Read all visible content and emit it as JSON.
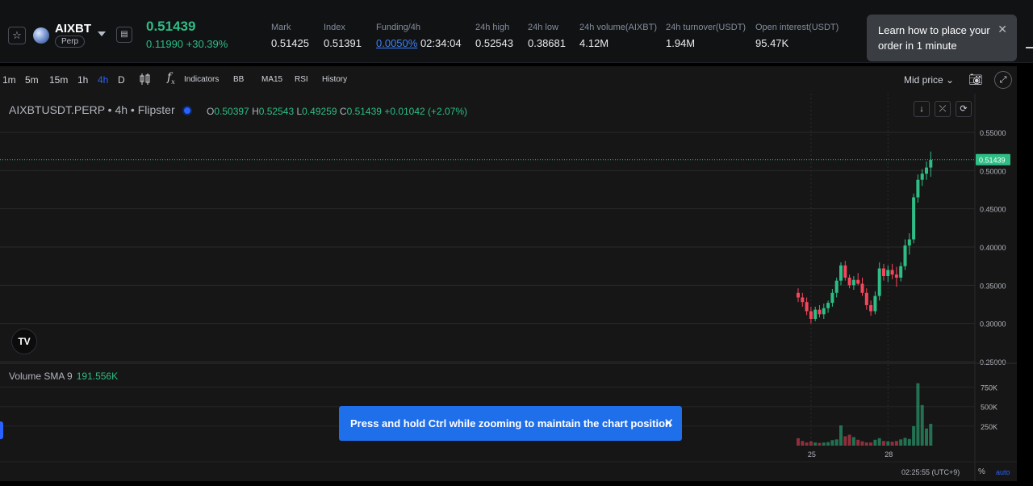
{
  "header": {
    "symbol": "AIXBT",
    "contract_type": "Perp",
    "last_price": "0.51439",
    "change": "0.11990 +30.39%",
    "stats": [
      {
        "label": "Mark",
        "value": "0.51425"
      },
      {
        "label": "Index",
        "value": "0.51391"
      },
      {
        "label": "Funding/4h",
        "rate": "0.0050%",
        "countdown": "02:34:04"
      },
      {
        "label": "24h high",
        "value": "0.52543"
      },
      {
        "label": "24h low",
        "value": "0.38681"
      },
      {
        "label": "24h volume(AIXBT)",
        "value": "4.12M"
      },
      {
        "label": "24h turnover(USDT)",
        "value": "1.94M"
      },
      {
        "label": "Open interest(USDT)",
        "value": "95.47K"
      }
    ],
    "tooltip": "Learn how to place your order in 1 minute"
  },
  "toolbar": {
    "timeframes": [
      "1m",
      "5m",
      "15m",
      "1h",
      "4h",
      "D"
    ],
    "active_timeframe": "4h",
    "indicators_label": "Indicators",
    "tools": [
      "BB",
      "MA15",
      "RSI",
      "History"
    ],
    "price_mode": "Mid price"
  },
  "legend": {
    "title": "AIXBTUSDT.PERP • 4h • Flipster",
    "o": "0.50397",
    "h": "0.52543",
    "l": "0.49259",
    "c": "0.51439",
    "change": "+0.01042 (+2.07%)"
  },
  "volume": {
    "label": "Volume SMA 9",
    "value": "191.556K"
  },
  "toast": "Press and hold Ctrl while zooming to maintain the chart position",
  "footer": {
    "time": "02:25:55 (UTC+9)",
    "percent": "%",
    "auto": "auto"
  },
  "colors": {
    "up": "#2ebd85",
    "down": "#f6465d",
    "accent": "#2962ff"
  },
  "chart_data": {
    "type": "candlestick",
    "symbol": "AIXBTUSDT.PERP",
    "interval": "4h",
    "price_axis": {
      "ticks": [
        "0.55000",
        "0.50000",
        "0.45000",
        "0.40000",
        "0.35000",
        "0.30000",
        "0.25000"
      ],
      "range": [
        0.25,
        0.55
      ]
    },
    "volume_axis": {
      "ticks": [
        "750K",
        "500K",
        "250K"
      ],
      "range": [
        0,
        880000
      ]
    },
    "x_ticks": [
      {
        "label": "25",
        "index": 3
      },
      {
        "label": "28",
        "index": 21
      }
    ],
    "last_price_tag": "0.51439",
    "candles": [
      [
        0.34,
        0.346,
        0.328,
        0.334
      ],
      [
        0.334,
        0.34,
        0.322,
        0.328
      ],
      [
        0.328,
        0.334,
        0.311,
        0.316
      ],
      [
        0.316,
        0.322,
        0.3,
        0.306
      ],
      [
        0.306,
        0.322,
        0.303,
        0.318
      ],
      [
        0.318,
        0.324,
        0.308,
        0.312
      ],
      [
        0.312,
        0.326,
        0.306,
        0.32
      ],
      [
        0.32,
        0.33,
        0.314,
        0.327
      ],
      [
        0.327,
        0.345,
        0.322,
        0.34
      ],
      [
        0.34,
        0.36,
        0.334,
        0.356
      ],
      [
        0.356,
        0.38,
        0.35,
        0.376
      ],
      [
        0.376,
        0.382,
        0.356,
        0.36
      ],
      [
        0.36,
        0.364,
        0.346,
        0.35
      ],
      [
        0.35,
        0.362,
        0.344,
        0.357
      ],
      [
        0.357,
        0.366,
        0.35,
        0.352
      ],
      [
        0.352,
        0.36,
        0.336,
        0.34
      ],
      [
        0.34,
        0.346,
        0.318,
        0.324
      ],
      [
        0.324,
        0.33,
        0.31,
        0.316
      ],
      [
        0.316,
        0.342,
        0.312,
        0.336
      ],
      [
        0.336,
        0.38,
        0.33,
        0.372
      ],
      [
        0.372,
        0.378,
        0.356,
        0.362
      ],
      [
        0.362,
        0.376,
        0.354,
        0.37
      ],
      [
        0.37,
        0.378,
        0.358,
        0.364
      ],
      [
        0.364,
        0.374,
        0.348,
        0.36
      ],
      [
        0.36,
        0.38,
        0.355,
        0.375
      ],
      [
        0.375,
        0.41,
        0.37,
        0.402
      ],
      [
        0.402,
        0.418,
        0.39,
        0.41
      ],
      [
        0.41,
        0.47,
        0.405,
        0.465
      ],
      [
        0.465,
        0.495,
        0.458,
        0.488
      ],
      [
        0.488,
        0.502,
        0.48,
        0.496
      ],
      [
        0.496,
        0.512,
        0.488,
        0.504
      ],
      [
        0.504,
        0.525,
        0.492,
        0.514
      ]
    ],
    "volumes": [
      95000,
      60000,
      40000,
      55000,
      40000,
      35000,
      40000,
      45000,
      70000,
      80000,
      260000,
      120000,
      140000,
      110000,
      75000,
      55000,
      40000,
      40000,
      75000,
      95000,
      60000,
      55000,
      50000,
      60000,
      80000,
      100000,
      85000,
      250000,
      800000,
      520000,
      220000,
      280000
    ]
  }
}
